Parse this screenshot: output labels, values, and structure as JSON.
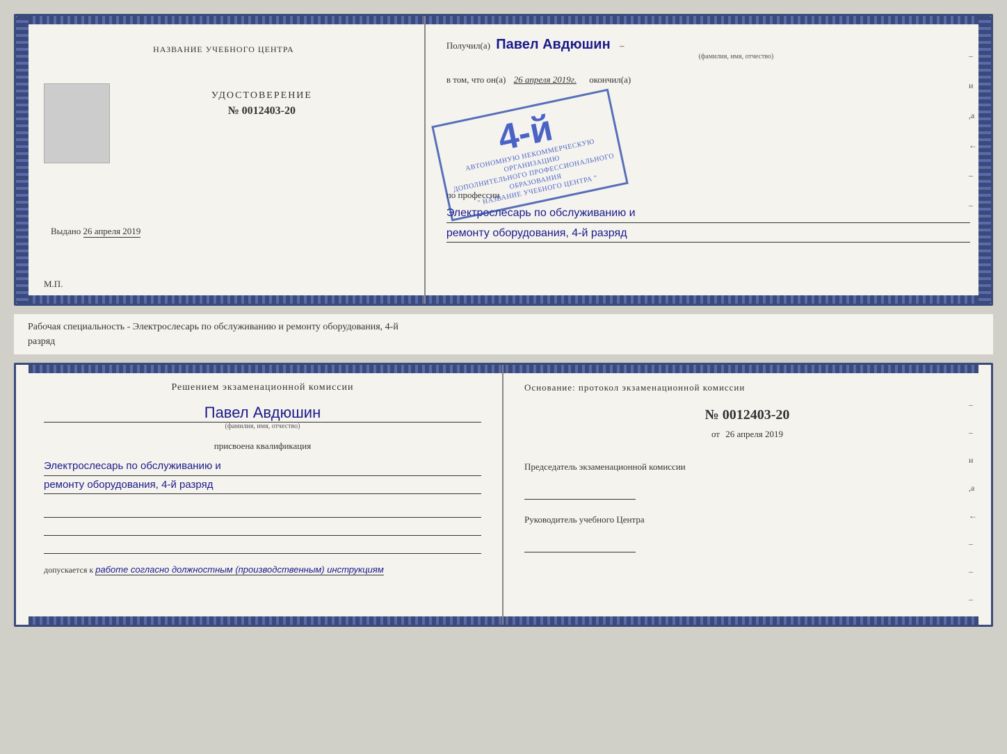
{
  "top_booklet": {
    "left": {
      "org_name": "НАЗВАНИЕ УЧЕБНОГО ЦЕНТРА",
      "photo_alt": "фото",
      "cert_label": "УДОСТОВЕРЕНИЕ",
      "cert_number_prefix": "№",
      "cert_number": "0012403-20",
      "issued_label": "Выдано",
      "issued_date": "26 апреля 2019",
      "mp_label": "М.П."
    },
    "right": {
      "received_label": "Получил(а)",
      "person_name": "Павел Авдюшин",
      "person_subtitle": "(фамилия, имя, отчество)",
      "dash": "–",
      "in_that_label": "в том, что он(а)",
      "date_value": "26 апреля 2019г.",
      "finished_label": "окончил(а)",
      "stamp_grade": "4-й",
      "stamp_line1": "АВТОНОМНУЮ НЕКОММЕРЧЕСКУЮ ОРГАНИЗАЦИЮ",
      "stamp_line2": "ДОПОЛНИТЕЛЬНОГО ПРОФЕССИОНАЛЬНОГО ОБРАЗОВАНИЯ",
      "stamp_line3": "\" НАЗВАНИЕ УЧЕБНОГО ЦЕНТРА \"",
      "profession_label": "по профессии",
      "profession_line1": "Электрослесарь по обслуживанию и",
      "profession_line2": "ремонту оборудования, 4-й разряд"
    },
    "side_marks": [
      "-",
      "и",
      ",а",
      "←",
      "–"
    ]
  },
  "middle_text": {
    "line1": "Рабочая специальность - Электрослесарь по обслуживанию и ремонту оборудования, 4-й",
    "line2": "разряд"
  },
  "bottom_booklet": {
    "left": {
      "decision_title": "Решением экзаменационной комиссии",
      "person_name": "Павел Авдюшин",
      "person_subtitle": "(фамилия, имя, отчество)",
      "qualification_label": "присвоена квалификация",
      "qualification_line1": "Электрослесарь по обслуживанию и",
      "qualification_line2": "ремонту оборудования, 4-й разряд",
      "допускается_label": "допускается к",
      "допускается_value": "работе согласно должностным (производственным) инструкциям"
    },
    "right": {
      "osnov_label": "Основание: протокол экзаменационной комиссии",
      "protocol_prefix": "№",
      "protocol_number": "0012403-20",
      "from_prefix": "от",
      "from_date": "26 апреля 2019",
      "chairman_label": "Председатель экзаменационной комиссии",
      "director_label": "Руководитель учебного Центра"
    },
    "side_marks": [
      "-",
      "–",
      "–",
      "и",
      ",а",
      "←",
      "–",
      "–",
      "–"
    ]
  }
}
